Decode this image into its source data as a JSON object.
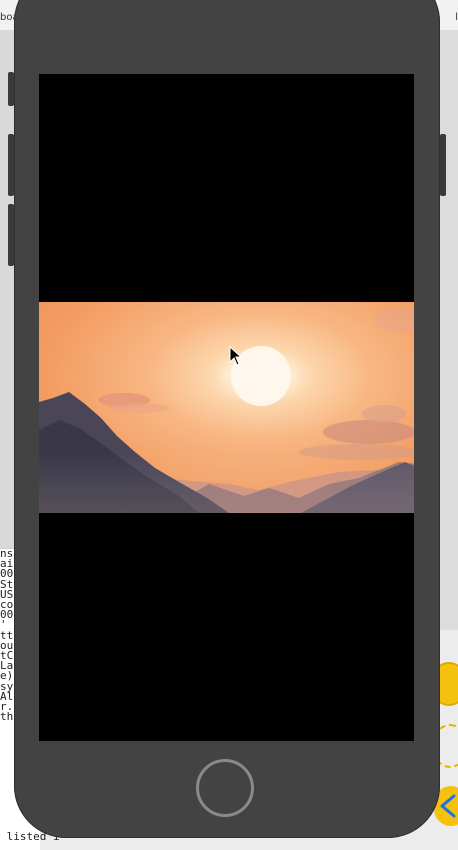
{
  "ide": {
    "top_left_snippet": "boa",
    "top_right_snippet": "l",
    "console_lines": [
      "ns",
      "ai",
      "00",
      "St",
      "US",
      "co",
      "00",
      "'",
      "",
      "tt",
      "ou",
      "tC",
      "La",
      "e)",
      "",
      "sy",
      "Al",
      "r.",
      "thods"
    ],
    "console_footer": " listed i"
  },
  "device": {
    "model": "iPhone simulator",
    "frame_color": "#434343",
    "screen_background": "#000000"
  },
  "screen": {
    "image_alt": "sunset over mountains landscape",
    "image_colors": {
      "sky_top": "#f29a5e",
      "sun": "#fff7ea",
      "mountains_dark": "#3f3d4d",
      "mountains_mid": "#7b6a74"
    }
  },
  "icons": {
    "home": "home-button",
    "cursor": "arrow-cursor-icon",
    "assistant_back": "chevron-left-icon"
  }
}
